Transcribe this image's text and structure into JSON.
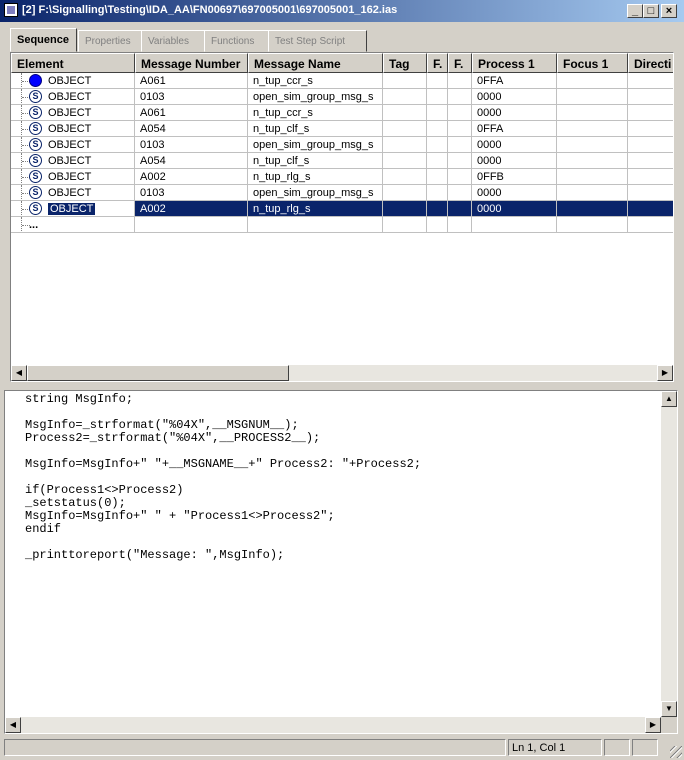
{
  "window": {
    "title": "[2] F:\\Signalling\\Testing\\IDA_AA\\FN00697\\697005001\\697005001_162.ias",
    "minimize": "_",
    "restore": "□",
    "close": "×"
  },
  "tabs": [
    {
      "label": "Sequence"
    },
    {
      "label": "Properties"
    },
    {
      "label": "Variables"
    },
    {
      "label": "Functions"
    },
    {
      "label": "Test Step Script"
    }
  ],
  "grid": {
    "columns": [
      "Element",
      "Message Number",
      "Message Name",
      "Tag",
      "F.",
      "F.",
      "Process 1",
      "Focus 1",
      "Directi"
    ],
    "rows": [
      {
        "icon": "blue-dot-icon",
        "element": "OBJECT",
        "msg_num": "A061",
        "msg_name": "n_tup_ccr_s",
        "process1": "0FFA"
      },
      {
        "icon": "s-circle-icon",
        "element": "OBJECT",
        "msg_num": "0103",
        "msg_name": "open_sim_group_msg_s",
        "process1": "0000"
      },
      {
        "icon": "s-circle-icon",
        "element": "OBJECT",
        "msg_num": "A061",
        "msg_name": "n_tup_ccr_s",
        "process1": "0000"
      },
      {
        "icon": "s-circle-icon",
        "element": "OBJECT",
        "msg_num": "A054",
        "msg_name": "n_tup_clf_s",
        "process1": "0FFA"
      },
      {
        "icon": "s-circle-icon",
        "element": "OBJECT",
        "msg_num": "0103",
        "msg_name": "open_sim_group_msg_s",
        "process1": "0000"
      },
      {
        "icon": "s-circle-icon",
        "element": "OBJECT",
        "msg_num": "A054",
        "msg_name": "n_tup_clf_s",
        "process1": "0000"
      },
      {
        "icon": "s-circle-icon",
        "element": "OBJECT",
        "msg_num": "A002",
        "msg_name": "n_tup_rlg_s",
        "process1": "0FFB"
      },
      {
        "icon": "s-circle-icon",
        "element": "OBJECT",
        "msg_num": "0103",
        "msg_name": "open_sim_group_msg_s",
        "process1": "0000"
      },
      {
        "icon": "s-circle-icon",
        "element": "OBJECT",
        "msg_num": "A002",
        "msg_name": "n_tup_rlg_s",
        "process1": "0000",
        "selected": true
      }
    ],
    "ellipsis": "...",
    "icon_glyph": "S"
  },
  "code": {
    "lines": [
      "string MsgInfo;",
      "",
      "MsgInfo=_strformat(\"%04X\",__MSGNUM__);",
      "Process2=_strformat(\"%04X\",__PROCESS2__);",
      "",
      "MsgInfo=MsgInfo+\" \"+__MSGNAME__+\" Process2: \"+Process2;",
      "",
      "if(Process1<>Process2)",
      "_setstatus(0);",
      "MsgInfo=MsgInfo+\" \" + \"Process1<>Process2\";",
      "endif",
      "",
      "_printtoreport(\"Message: \",MsgInfo);"
    ]
  },
  "status": {
    "position": "Ln 1, Col 1"
  },
  "colors": {
    "selection": "#0a246a",
    "keyword": "#000080"
  }
}
